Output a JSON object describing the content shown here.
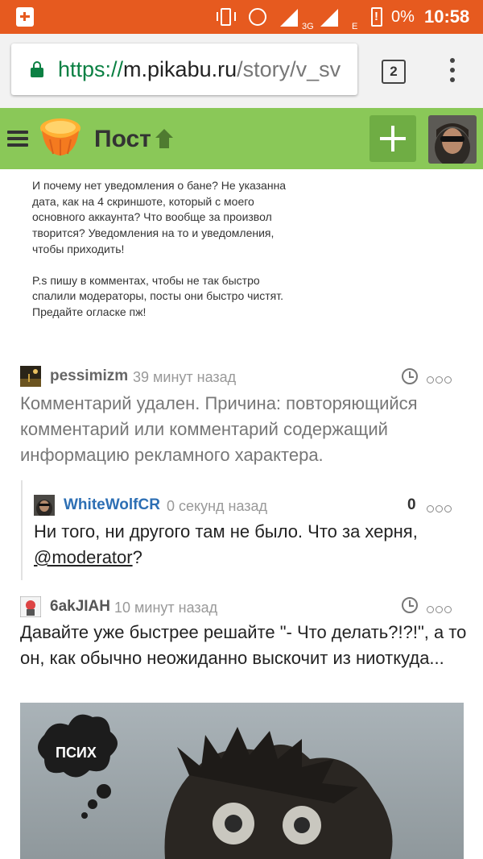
{
  "status_bar": {
    "network_3g": "3G",
    "network_e": "E",
    "battery_percent": "0%",
    "time": "10:58"
  },
  "browser": {
    "url_scheme": "https://",
    "url_host": "m.pikabu.ru",
    "url_path": "/story/v_sv",
    "tab_count": "2"
  },
  "header": {
    "title": "Пост",
    "up_arrow": "🡑"
  },
  "story": {
    "paragraph1": "И почему нет уведомления о бане? Не указанна\nдата, как на 4 скриншоте, который с моего\nосновного аккаунта? Что вообще за произвол\nтворится? Уведомления на то и уведомления,\nчтобы приходить!",
    "paragraph2": "P.s пишу в комментах, чтобы не так быстро\nспалили модераторы, посты они быстро чистят.\nПредайте огласке пж!"
  },
  "comments": [
    {
      "author": "pessimizm",
      "time": "39 минут назад",
      "text": "Комментарий удален. Причина: повторяющийся комментарий или комментарий содержащий информацию рекламного характера.",
      "author_color": "#666666"
    },
    {
      "author": "WhiteWolfCR",
      "time": "0 секунд назад",
      "rating": "0",
      "text_before": "Ни того, ни другого там не было. Что за херня, ",
      "mention": "@moderator",
      "text_after": "?",
      "author_color": "#2d6fb4"
    },
    {
      "author": "6akJIAH",
      "time": "10 минут назад",
      "text": "Давайте уже быстрее решайте \"- Что делать?!?!\", а то он, как обычно неожиданно выскочит из ниоткуда...",
      "author_color": "#555555"
    }
  ],
  "comment_image": {
    "bubble_text": "ПСИХ"
  },
  "colors": {
    "status_bar": "#e65a1f",
    "app_bar": "#8ac858",
    "add_button": "#6fad44",
    "secure_green": "#0b8043"
  }
}
